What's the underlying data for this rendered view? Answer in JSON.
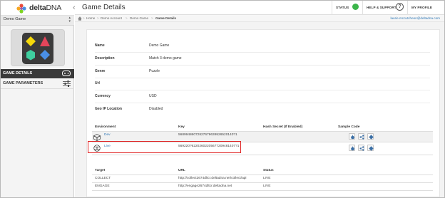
{
  "brand": {
    "name_bold": "delta",
    "name_light": "DNA",
    "collapse_glyph": "‹"
  },
  "game_selector": {
    "value": "Demo Game"
  },
  "sidebar": {
    "items": [
      {
        "label": "GAME DETAILS",
        "active": true
      },
      {
        "label": "GAME PARAMETERS",
        "active": false
      }
    ]
  },
  "topbar": {
    "title": "Game Details",
    "status_label": "STATUS",
    "status_color": "#3bb54a",
    "help_label": "HELP & SUPPORT",
    "help_glyph": "?",
    "profile_label": "MY PROFILE"
  },
  "breadcrumb": {
    "items": [
      "Home",
      "Demo Account",
      "Demo Game",
      "Game Details"
    ],
    "separator": ">",
    "user_email": "laurie.mccutcheon@deltadna.com"
  },
  "details": {
    "rows": [
      {
        "label": "Name",
        "value": "Demo Game"
      },
      {
        "label": "Description",
        "value": "Match 3 demo game"
      },
      {
        "label": "Genre",
        "value": "Puzzle"
      },
      {
        "label": "Url",
        "value": ""
      },
      {
        "label": "Currency",
        "value": "USD"
      },
      {
        "label": "Geo IP Location",
        "value": "Disabled"
      }
    ]
  },
  "environments": {
    "headers": {
      "environment": "Environment",
      "key": "Key",
      "hash_secret": "Hash Secret (If Enabled)",
      "sample_code": "Sample Code"
    },
    "rows": [
      {
        "name": "Dev",
        "icon": "cube-icon",
        "key": "56899486072827679639526520140?1",
        "hash": ""
      },
      {
        "name": "Live",
        "icon": "globe-icon",
        "key": "569220?62202602205677209481407?1",
        "hash": ""
      }
    ],
    "sample_code_icons": [
      "apple-icon",
      "share-icon",
      "diamond-icon"
    ]
  },
  "targets": {
    "headers": {
      "target": "Target",
      "url": "URL",
      "status": "Status"
    },
    "rows": [
      {
        "target": "COLLECT",
        "url": "http://collect2674dltcr.deltadna.net/collect/api",
        "status": "LIVE"
      },
      {
        "target": "ENGAGE",
        "url": "http://engage2674dltcr.deltadna.net",
        "status": "LIVE"
      }
    ]
  },
  "colors": {
    "accent_link": "#337ab7",
    "highlight_box": "#e02424",
    "sidebar_active": "#3a3a3a"
  }
}
